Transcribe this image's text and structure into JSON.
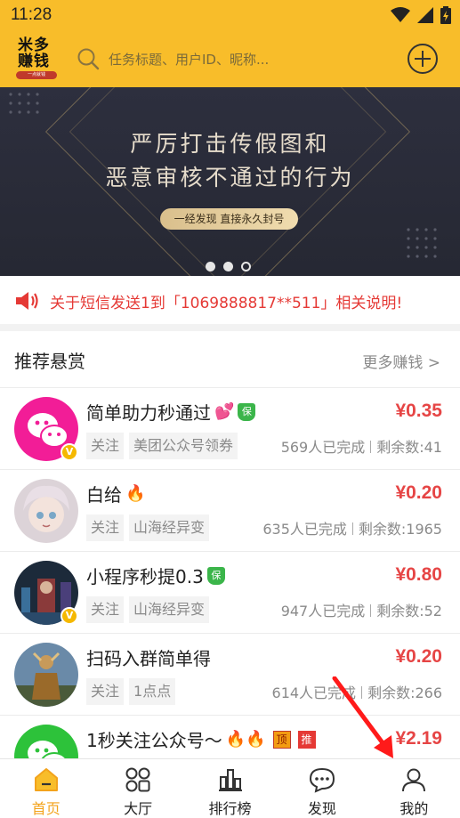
{
  "status_bar": {
    "time": "11:28"
  },
  "header": {
    "logo_line1": "米多",
    "logo_line2": "赚钱",
    "logo_tagline": "一点就钱",
    "search_placeholder": "任务标题、用户ID、昵称..."
  },
  "banner": {
    "line1": "严厉打击传假图和",
    "line2": "恶意审核不通过的行为",
    "pill": "一经发现 直接永久封号",
    "pages": 3,
    "current_page": 2
  },
  "notice": {
    "text": "关于短信发送1到「1069888817**511」相关说明!"
  },
  "section": {
    "title": "推荐悬赏",
    "more": "更多赚钱 >"
  },
  "tasks": [
    {
      "title": "简单助力秒通过",
      "emoji": "💕",
      "badges": [
        "保"
      ],
      "price": "¥0.35",
      "tags": [
        "关注",
        "美团公众号领券"
      ],
      "completed": "569人已完成",
      "remaining": "剩余数:41",
      "verified": true
    },
    {
      "title": "白给",
      "emoji": "🔥",
      "badges": [],
      "price": "¥0.20",
      "tags": [
        "关注",
        "山海经异变"
      ],
      "completed": "635人已完成",
      "remaining": "剩余数:1965",
      "verified": false
    },
    {
      "title": "小程序秒提0.3",
      "emoji": "",
      "badges": [
        "保"
      ],
      "price": "¥0.80",
      "tags": [
        "关注",
        "山海经异变"
      ],
      "completed": "947人已完成",
      "remaining": "剩余数:52",
      "verified": true
    },
    {
      "title": "扫码入群简单得",
      "emoji": "",
      "badges": [],
      "price": "¥0.20",
      "tags": [
        "关注",
        "1点点"
      ],
      "completed": "614人已完成",
      "remaining": "剩余数:266",
      "verified": false
    },
    {
      "title": "1秒关注公众号～",
      "emoji": "🔥🔥",
      "badges": [
        "顶",
        "推"
      ],
      "price": "¥2.19",
      "tags": [],
      "completed": "",
      "remaining": "",
      "verified": false
    }
  ],
  "tabbar": [
    {
      "label": "首页",
      "icon": "home-icon",
      "active": true
    },
    {
      "label": "大厅",
      "icon": "grid-icon",
      "active": false
    },
    {
      "label": "排行榜",
      "icon": "ranking-icon",
      "active": false
    },
    {
      "label": "发现",
      "icon": "chat-icon",
      "active": false
    },
    {
      "label": "我的",
      "icon": "user-icon",
      "active": false
    }
  ],
  "colors": {
    "brand": "#f8bd2a",
    "price": "#e64545",
    "notice": "#e53935",
    "active_tab": "#f3a31c"
  }
}
